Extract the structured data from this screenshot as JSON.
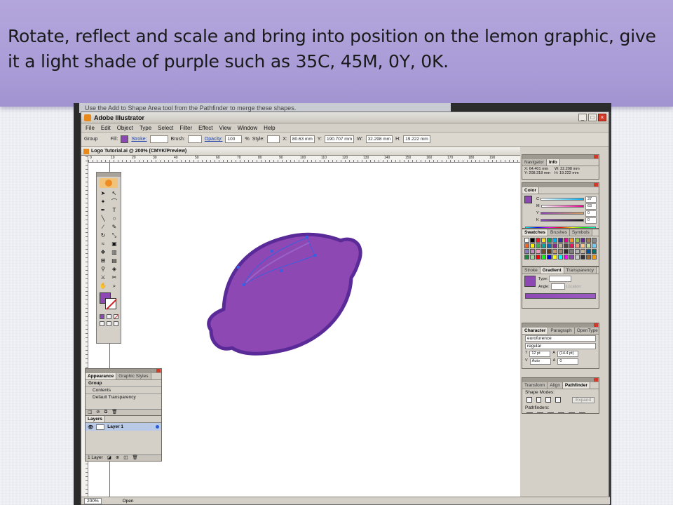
{
  "slide": {
    "caption": "Rotate, reflect and scale and bring into position on the lemon graphic, give it a light shade of purple such as 35C, 45M, 0Y, 0K."
  },
  "behind_window_text": "Use the Add to Shape Area tool from the Pathfinder to merge these shapes.",
  "app": {
    "title": "Adobe Illustrator",
    "menu": [
      "File",
      "Edit",
      "Object",
      "Type",
      "Select",
      "Filter",
      "Effect",
      "View",
      "Window",
      "Help"
    ],
    "control_bar": {
      "selection": "Group",
      "fill_label": "Fill:",
      "stroke_label": "Stroke:",
      "brush_label": "Brush:",
      "opacity_label": "Opacity:",
      "opacity_value": "100",
      "opacity_unit": "%",
      "style_label": "Style:",
      "x_label": "X:",
      "x_value": "80.63 mm",
      "y_label": "Y:",
      "y_value": "190.707 mm",
      "w_label": "W:",
      "w_value": "32.298 mm",
      "h_label": "H:",
      "h_value": "19.222 mm"
    },
    "document_tab": "Logo Tutorial.ai @ 200% (CMYK/Preview)",
    "ruler_numbers": [
      "0",
      "10",
      "20",
      "30",
      "40",
      "50",
      "60",
      "70",
      "80",
      "90",
      "100",
      "110",
      "120",
      "130",
      "140",
      "150",
      "160",
      "170",
      "180",
      "190"
    ],
    "status": {
      "zoom": "200%",
      "state": "Open"
    }
  },
  "panels": {
    "info": {
      "tabs": [
        "Navigator",
        "Info"
      ],
      "x": "X: 64.401 mm",
      "y": "Y: 208.318 mm",
      "w": "W: 32.298 mm",
      "h": "H: 19.222 mm"
    },
    "color": {
      "tab": "Color",
      "channels": [
        {
          "label": "C",
          "value": "37"
        },
        {
          "label": "M",
          "value": "63"
        },
        {
          "label": "Y",
          "value": "0"
        },
        {
          "label": "K",
          "value": "0"
        }
      ]
    },
    "swatches": {
      "tabs": [
        "Swatches",
        "Brushes",
        "Symbols"
      ],
      "colors": [
        "#ffffff",
        "#000000",
        "#ed1c24",
        "#ffde17",
        "#00a651",
        "#00aeef",
        "#2e3192",
        "#ec008c",
        "#f7941d",
        "#8dc63f",
        "#662d91",
        "#a67c52",
        "#898989",
        "#f26522",
        "#fff200",
        "#39b54a",
        "#00a99d",
        "#0072bc",
        "#92278f",
        "#c2b59b",
        "#534741",
        "#ed145b",
        "#f69679",
        "#fdc689",
        "#c4df9b",
        "#6dcff6",
        "#8781bd",
        "#bd8cbf",
        "#f49ac1",
        "#754c24",
        "#603913",
        "#c69c6d",
        "#998675",
        "#362f2d",
        "#7d7d7d",
        "#b7b7b7",
        "#c7b299",
        "#0054a6",
        "#00746b",
        "#198b3a",
        "#a3d39c",
        "#ff0000",
        "#00ff00",
        "#0000ff",
        "#ffff00",
        "#00ffff",
        "#ff00ff",
        "#8e48b4",
        "#cccccc",
        "#333333",
        "#996633",
        "#ff9900"
      ]
    },
    "gradient": {
      "tabs": [
        "Stroke",
        "Gradient",
        "Transparency"
      ],
      "type_label": "Type:",
      "angle_label": "Angle:",
      "location_label": "Location:"
    },
    "character": {
      "tabs": [
        "Character",
        "Paragraph",
        "OpenType"
      ],
      "font": "eurofurence",
      "style": "regular",
      "size": "12 pt",
      "leading": "(14.4 pt)",
      "kerning": "Auto",
      "tracking": "0"
    },
    "pathfinder": {
      "tabs": [
        "Transform",
        "Align",
        "Pathfinder"
      ],
      "shape_modes": "Shape Modes:",
      "expand": "Expand",
      "pathfinders": "Pathfinders:"
    },
    "appearance": {
      "tabs": [
        "Appearance",
        "Graphic Styles"
      ],
      "rows": [
        "Group",
        "Contents",
        "Default Transparency"
      ]
    },
    "layers": {
      "tab": "Layers",
      "layer_name": "Layer 1",
      "footer": "1 Layer"
    }
  },
  "colors": {
    "lemon_fill": "#8e48b4",
    "lemon_stroke": "#5a2b98",
    "leaf_outline": "#3a5fe0",
    "header_band": "#ab9dd8"
  }
}
